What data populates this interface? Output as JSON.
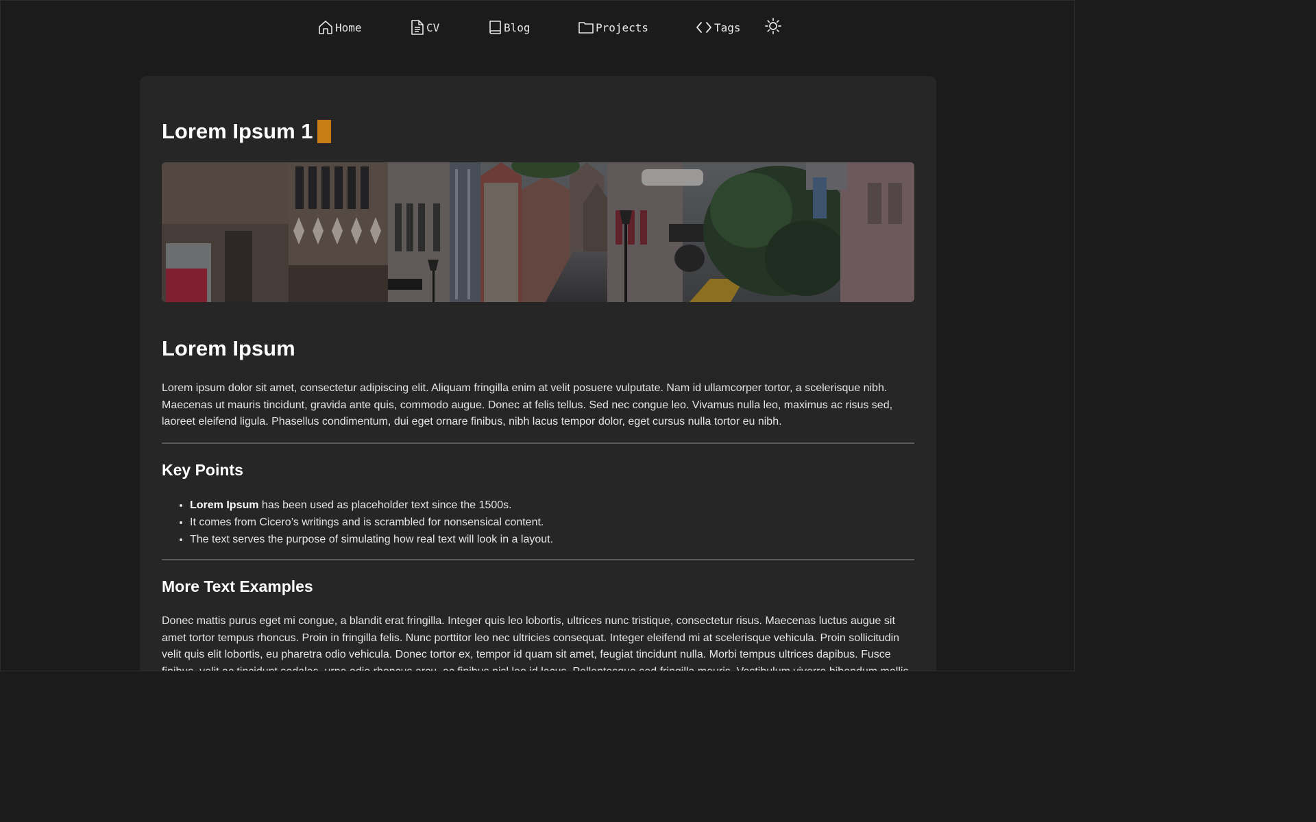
{
  "nav": {
    "home": "Home",
    "cv": "CV",
    "blog": "Blog",
    "projects": "Projects",
    "tags": "Tags",
    "icons": [
      "home-icon",
      "document-icon",
      "book-icon",
      "folder-icon",
      "code-icon",
      "sun-icon"
    ]
  },
  "post": {
    "title": "Lorem Ipsum 1",
    "accent_color": "#c77d14",
    "hero_image": "street-photo"
  },
  "article": {
    "heading": "Lorem Ipsum",
    "intro": "Lorem ipsum dolor sit amet, consectetur adipiscing elit. Aliquam fringilla enim at velit posuere vulputate. Nam id ullamcorper tortor, a scelerisque nibh. Maecenas ut mauris tincidunt, gravida ante quis, commodo augue. Donec at felis tellus. Sed nec congue leo. Vivamus nulla leo, maximus ac risus sed, laoreet eleifend ligula. Phasellus condimentum, dui eget ornare finibus, nibh lacus tempor dolor, eget cursus nulla tortor eu nibh.",
    "key_points_heading": "Key Points",
    "key_points": [
      {
        "bold": "Lorem Ipsum",
        "text": " has been used as placeholder text since the 1500s."
      },
      {
        "bold": "",
        "text": "It comes from Cicero’s writings and is scrambled for nonsensical content."
      },
      {
        "bold": "",
        "text": "The text serves the purpose of simulating how real text will look in a layout."
      }
    ],
    "more_heading": "More Text Examples",
    "more_text": "Donec mattis purus eget mi congue, a blandit erat fringilla. Integer quis leo lobortis, ultrices nunc tristique, consectetur risus. Maecenas luctus augue sit amet tortor tempus rhoncus. Proin in fringilla felis. Nunc porttitor leo nec ultricies consequat. Integer eleifend mi at scelerisque vehicula. Proin sollicitudin velit quis elit lobortis, eu pharetra odio vehicula. Donec tortor ex, tempor id quam sit amet, feugiat tincidunt nulla. Morbi tempus ultrices dapibus. Fusce finibus, velit ac tincidunt sodales, urna odio rhoncus arcu, ac finibus nisl leo id lacus. Pellentesque sed fringilla mauris. Vestibulum viverra bibendum mollis."
  },
  "colors": {
    "background": "#1b1b1b",
    "card": "#262626",
    "accent": "#c77d14",
    "divider": "#5a5a5a"
  }
}
